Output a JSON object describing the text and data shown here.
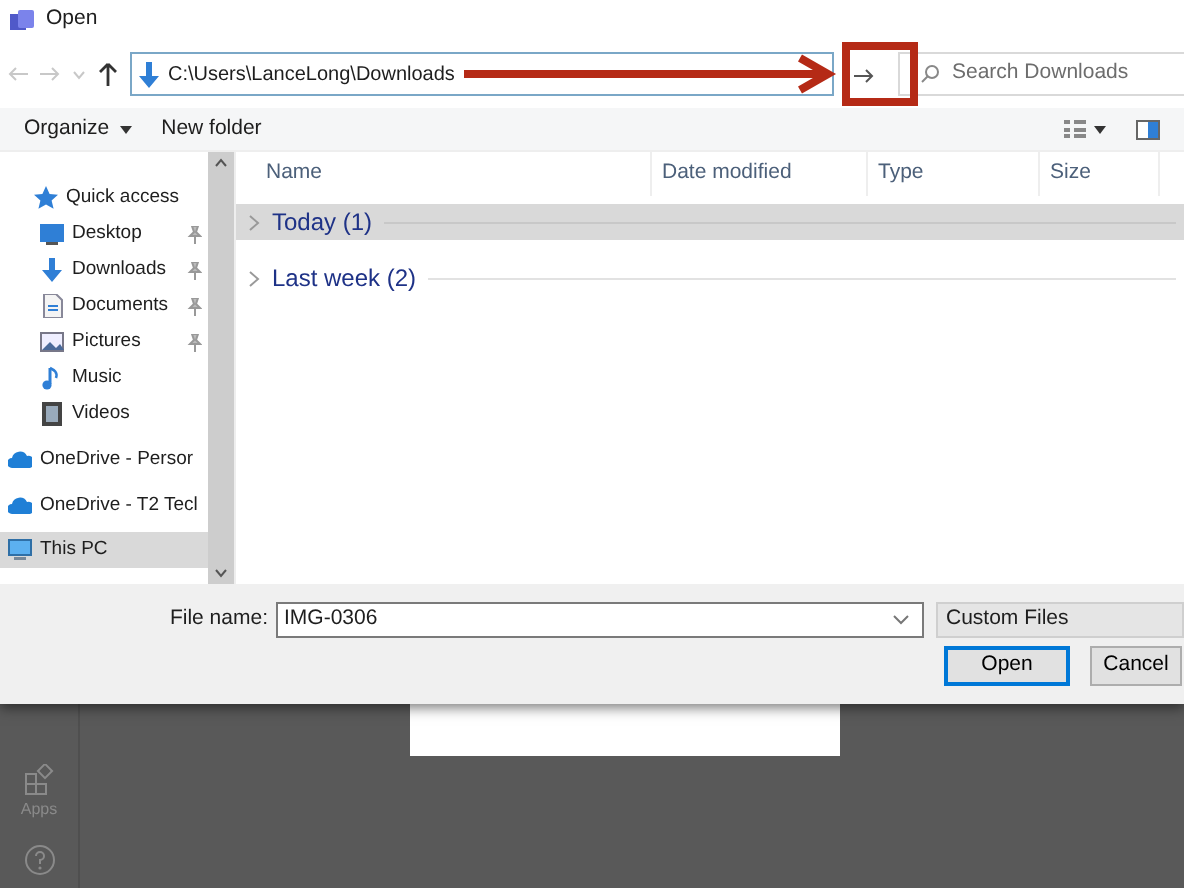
{
  "window": {
    "title": "Open"
  },
  "nav": {
    "address": "C:\\Users\\LanceLong\\Downloads",
    "search_placeholder": "Search Downloads"
  },
  "toolbar": {
    "organize": "Organize",
    "new_folder": "New folder"
  },
  "sidebar": {
    "items": [
      {
        "label": "Quick access",
        "kind": "star",
        "pinned": false,
        "selected": false,
        "children": [
          {
            "label": "Desktop",
            "kind": "desktop",
            "pinned": true,
            "selected": false
          },
          {
            "label": "Downloads",
            "kind": "download",
            "pinned": true,
            "selected": false
          },
          {
            "label": "Documents",
            "kind": "document",
            "pinned": true,
            "selected": false
          },
          {
            "label": "Pictures",
            "kind": "picture",
            "pinned": true,
            "selected": false
          },
          {
            "label": "Music",
            "kind": "music",
            "pinned": false,
            "selected": false
          },
          {
            "label": "Videos",
            "kind": "video",
            "pinned": false,
            "selected": false
          }
        ]
      },
      {
        "label": "OneDrive - Persor",
        "kind": "cloud",
        "pinned": false,
        "selected": false
      },
      {
        "label": "OneDrive - T2 Tecl",
        "kind": "cloud",
        "pinned": false,
        "selected": false
      },
      {
        "label": "This PC",
        "kind": "pc",
        "pinned": false,
        "selected": true
      }
    ]
  },
  "columns": [
    "Name",
    "Date modified",
    "Type",
    "Size"
  ],
  "groups": [
    {
      "label": "Today (1)",
      "selected": true
    },
    {
      "label": "Last week (2)",
      "selected": false
    }
  ],
  "footer": {
    "file_name_label": "File name:",
    "file_name": "IMG-0306",
    "file_type": "Custom Files",
    "buttons": [
      "Open",
      "Cancel"
    ]
  },
  "background": {
    "apps_label": "Apps"
  }
}
